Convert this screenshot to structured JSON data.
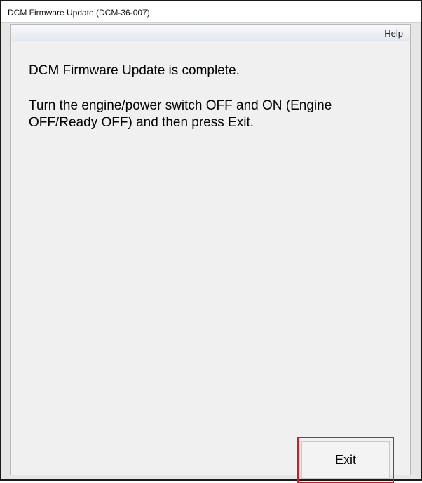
{
  "window": {
    "title": "DCM Firmware Update (DCM-36-007)"
  },
  "menu": {
    "help_label": "Help"
  },
  "message": {
    "line1": "DCM Firmware Update is complete.",
    "line2": "Turn the engine/power switch OFF and ON (Engine OFF/Ready OFF) and then press Exit."
  },
  "actions": {
    "exit_label": "Exit",
    "highlight_color": "#e0141e"
  }
}
